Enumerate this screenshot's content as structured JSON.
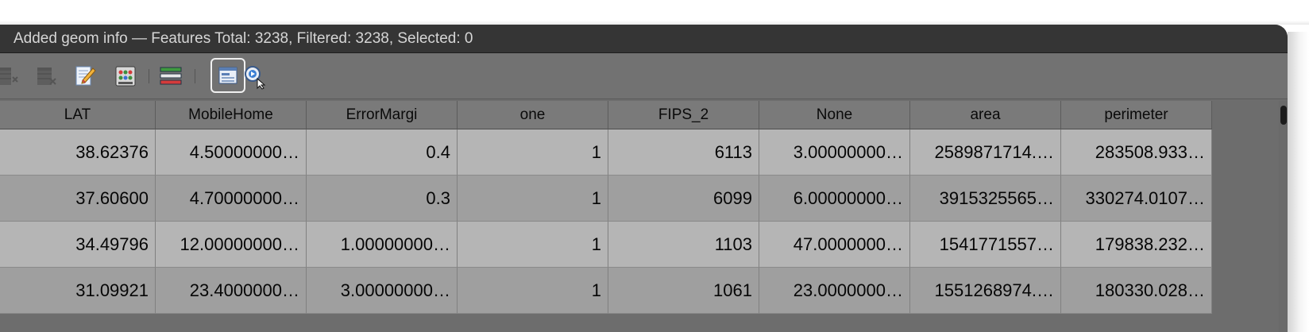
{
  "window": {
    "title": "Added geom info — Features Total: 3238, Filtered: 3238, Selected: 0"
  },
  "toolbar": {
    "icons": [
      "delete-field-icon",
      "delete-selected-icon",
      "edit-pencil-icon",
      "field-calculator-icon",
      "conditional-formatting-icon",
      "form-view-icon",
      "dock-view-icon",
      "zoom-to-selection-icon"
    ]
  },
  "table": {
    "columns": [
      "LAT",
      "MobileHome",
      "ErrorMargi",
      "one",
      "FIPS_2",
      "None",
      "area",
      "perimeter"
    ],
    "rows": [
      [
        "38.62376",
        "4.50000000…",
        "0.4",
        "1",
        "6113",
        "3.00000000…",
        "2589871714.…",
        "283508.933…"
      ],
      [
        "37.60600",
        "4.70000000…",
        "0.3",
        "1",
        "6099",
        "6.00000000…",
        "3915325565…",
        "330274.0107…"
      ],
      [
        "34.49796",
        "12.00000000…",
        "1.00000000…",
        "1",
        "1103",
        "47.0000000…",
        "1541771557…",
        "179838.232…"
      ],
      [
        "31.09921",
        "23.4000000…",
        "3.00000000…",
        "1",
        "1061",
        "23.0000000…",
        "1551268974.…",
        "180330.028…"
      ]
    ]
  },
  "colors": {
    "titlebar": "#353535",
    "toolbar": "#727272",
    "header": "#7a7a7a",
    "row_light": "#b5b5b5",
    "row_dark": "#9f9f9f"
  }
}
